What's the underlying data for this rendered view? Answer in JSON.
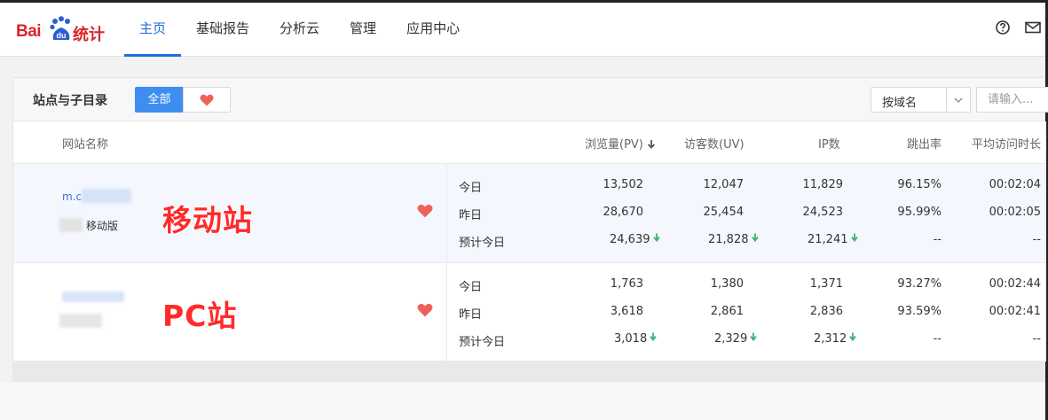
{
  "brand": {
    "prefix": "Bai",
    "paw_text": "du",
    "suffix": "统计",
    "color": "#d7262b"
  },
  "nav": {
    "items": [
      {
        "label": "主页",
        "active": true
      },
      {
        "label": "基础报告",
        "active": false
      },
      {
        "label": "分析云",
        "active": false
      },
      {
        "label": "管理",
        "active": false
      },
      {
        "label": "应用中心",
        "active": false
      }
    ],
    "accent": "#1e6fd9"
  },
  "header_icons": [
    "help-icon",
    "mail-icon"
  ],
  "panel": {
    "title": "站点与子目录",
    "filter_all": "全部",
    "filter_fav_icon": "heart-icon",
    "sort_value": "按域名",
    "search_placeholder": "请输入..."
  },
  "columns": {
    "site": "网站名称",
    "pv": "浏览量(PV)",
    "uv": "访客数(UV)",
    "ip": "IP数",
    "bounce": "跳出率",
    "avg": "平均访问时长"
  },
  "sites": [
    {
      "url": "m.c",
      "sub": "移动版",
      "overlay": "移动站",
      "rows": [
        {
          "label": "今日",
          "pv": "13,502",
          "uv": "12,047",
          "ip": "11,829",
          "bounce": "96.15%",
          "avg": "00:02:04"
        },
        {
          "label": "昨日",
          "pv": "28,670",
          "uv": "25,454",
          "ip": "24,523",
          "bounce": "95.99%",
          "avg": "00:02:05"
        },
        {
          "label": "预计今日",
          "pv": "24,639",
          "uv": "21,828",
          "ip": "21,241",
          "bounce": "--",
          "avg": "--"
        }
      ]
    },
    {
      "url": "",
      "sub": "",
      "overlay": "PC站",
      "rows": [
        {
          "label": "今日",
          "pv": "1,763",
          "uv": "1,380",
          "ip": "1,371",
          "bounce": "93.27%",
          "avg": "00:02:44"
        },
        {
          "label": "昨日",
          "pv": "3,618",
          "uv": "2,861",
          "ip": "2,836",
          "bounce": "93.59%",
          "avg": "00:02:41"
        },
        {
          "label": "预计今日",
          "pv": "3,018",
          "uv": "2,329",
          "ip": "2,312",
          "bounce": "--",
          "avg": "--"
        }
      ]
    }
  ],
  "colors": {
    "down_arrow": "#3cb371",
    "heart": "#f0605a",
    "overlay_text": "#ff2a2a"
  }
}
